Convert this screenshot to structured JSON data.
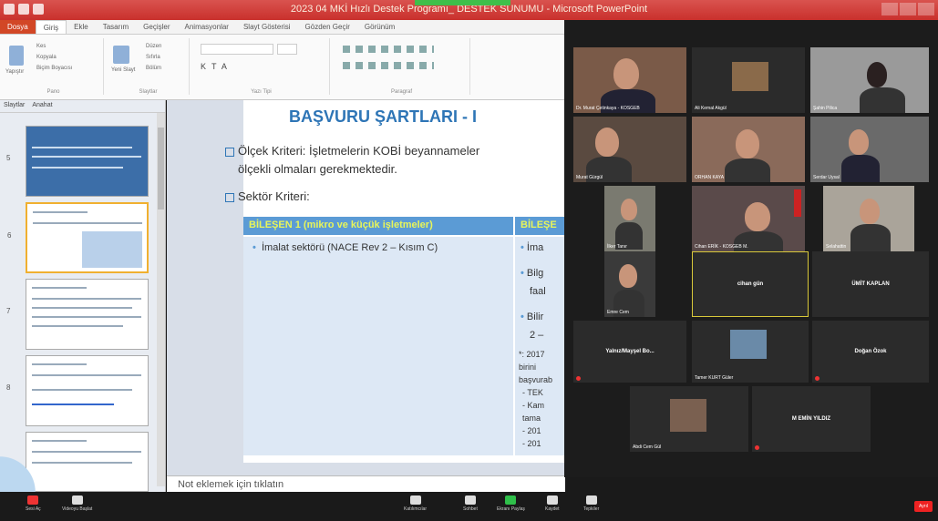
{
  "window": {
    "title": "2023 04 MKİ Hızlı Destek Programı_ DESTEK SUNUMU - Microsoft PowerPoint"
  },
  "ribbon": {
    "tabs": [
      "Dosya",
      "Giriş",
      "Ekle",
      "Tasarım",
      "Geçişler",
      "Animasyonlar",
      "Slayt Gösterisi",
      "Gözden Geçir",
      "Görünüm"
    ],
    "groups": [
      "Pano",
      "Slaytlar",
      "Yazı Tipi",
      "Paragraf"
    ],
    "paste": "Yapıştır",
    "cut": "Kes",
    "copy": "Kopyala",
    "format_painter": "Biçim Boyacısı",
    "new_slide": "Yeni Slayt",
    "layout": "Düzen",
    "reset": "Sıfırla",
    "section": "Bölüm"
  },
  "left_pane": {
    "tabs": [
      "Slaytlar",
      "Anahat"
    ],
    "numbers": [
      "5",
      "6",
      "7",
      "8",
      "9"
    ]
  },
  "slide": {
    "title": "BAŞVURU ŞARTLARI - I",
    "b1_line1": "Ölçek Kriteri: İşletmelerin KOBİ beyannameler",
    "b1_line2": "ölçekli olmaları gerekmektedir.",
    "b2": "Sektör Kriteri:",
    "col1_header": "BİLEŞEN 1 (mikro ve küçük işletmeler)",
    "col2_header": "BİLEŞE",
    "col1_item": "İmalat sektörü (NACE Rev 2 – Kısım C)",
    "col2_items": [
      "İma",
      "Bilg",
      "faal",
      "Bilir",
      "2 –",
      "*: 2017",
      "birini",
      "başvurab",
      "- TEK",
      "- Kam",
      "tama",
      "- 201",
      "- 201"
    ]
  },
  "notes": {
    "placeholder": "Not eklemek için tıklatın"
  },
  "zoom": {
    "participants": [
      {
        "name": "Dr. Murat Çetinkaya - KOSGEB"
      },
      {
        "name": "Ali Kemal Akgül"
      },
      {
        "name": "Şahin Pilica"
      },
      {
        "name": "Murat Gürgül"
      },
      {
        "name": "ORHAN KAYA"
      },
      {
        "name": "Serdar Uysal"
      },
      {
        "name": "İlker Tanır"
      },
      {
        "name": "Cihan ERİK - KOSGEB M."
      },
      {
        "name": "Selahattin"
      },
      {
        "name": "Emre Cem"
      },
      {
        "name": "cihan gün"
      },
      {
        "name": "ÜMİT KAPLAN"
      },
      {
        "name": "Yalnız/Mayşel Bo..."
      },
      {
        "name": "Tamer KURT Güler"
      },
      {
        "name": "Doğan Özok"
      },
      {
        "name": "Abdi Cem Gül"
      },
      {
        "name": "M EMİN YILDIZ"
      }
    ],
    "toolbar": [
      "Sesi Aç",
      "Videoyu Başlat",
      "Katılımcılar",
      "Sohbet",
      "Ekranı Paylaş",
      "Kaydet",
      "Tepkiler"
    ],
    "end": "Ayrıl"
  },
  "colors": {
    "accent": "#2e75b6",
    "table_header": "#5b9bd5",
    "header_text": "#e8f55a",
    "titlebar": "#c9302c"
  }
}
